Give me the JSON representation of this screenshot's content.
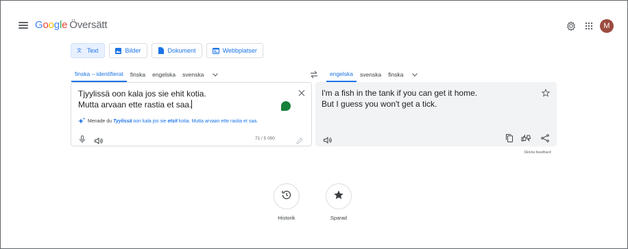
{
  "app": {
    "logo_text": "Google",
    "product_name": "Översätt",
    "avatar_initial": "M"
  },
  "modes": [
    {
      "label": "Text",
      "icon": "translate-icon",
      "active": true
    },
    {
      "label": "Bilder",
      "icon": "image-icon",
      "active": false
    },
    {
      "label": "Dokument",
      "icon": "document-icon",
      "active": false
    },
    {
      "label": "Webbplatser",
      "icon": "website-icon",
      "active": false
    }
  ],
  "source_langs": [
    "finska – identifierat",
    "finska",
    "engelska",
    "svenska"
  ],
  "target_langs": [
    "engelska",
    "svenska",
    "finska"
  ],
  "source": {
    "line1": "Tjyylissä oon kala jos sie ehit kotia.",
    "line2": "Mutta arvaan ette rastia et saa.",
    "suggestion_prefix": "Menade du",
    "suggestion_w1": "Tyylissä",
    "suggestion_mid": "oon kala jos sie",
    "suggestion_w2": "etsit",
    "suggestion_end": "kotia. Mutta arvaan ette rastia et saa.",
    "char_count": "71 / 5 000"
  },
  "target": {
    "line1": "I'm a fish in the tank if you can get it home.",
    "line2": "But I guess you won't get a tick."
  },
  "feedback": "Skicka feedback",
  "bottom": {
    "history": "Historik",
    "saved": "Sparad"
  },
  "colors": {
    "accent": "#1a73e8",
    "avatar": "#9c4b3f",
    "target_bg": "#f1f3f4"
  }
}
